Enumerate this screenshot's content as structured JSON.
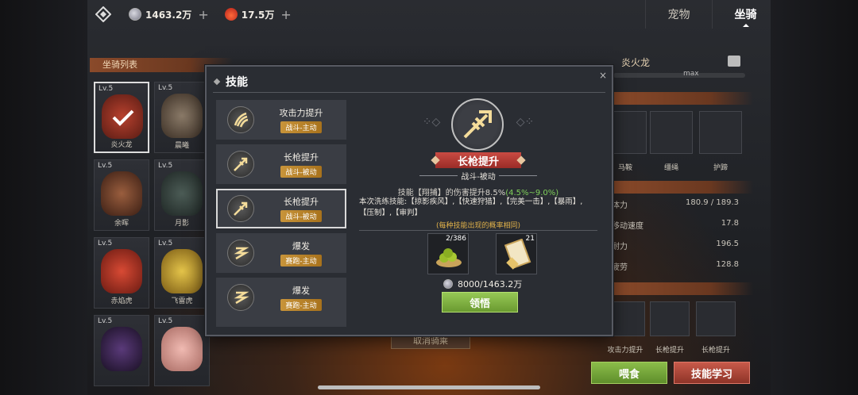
{
  "topbar": {
    "silver_amount": "1463.2万",
    "fire_amount": "17.5万",
    "tabs": [
      "宠物",
      "坐骑"
    ],
    "active_tab": "坐骑"
  },
  "mount_list": {
    "header": "坐骑列表",
    "items": [
      {
        "level": "Lv.5",
        "name": "炎火龙",
        "color": "#b8412e"
      },
      {
        "level": "Lv.5",
        "name": "晨曦",
        "color": "#6b5a48"
      },
      {
        "level": "Lv.5",
        "name": "余晖",
        "color": "#8a5338"
      },
      {
        "level": "Lv.5",
        "name": "月影",
        "color": "#3b4a44"
      },
      {
        "level": "Lv.5",
        "name": "赤焰虎",
        "color": "#c23a2a"
      },
      {
        "level": "Lv.5",
        "name": "飞雷虎",
        "color": "#d4b23a"
      },
      {
        "level": "Lv.5",
        "name": "",
        "color": "#3a2a4a"
      },
      {
        "level": "Lv.5",
        "name": "",
        "color": "#e0a7a0"
      }
    ]
  },
  "right_panel": {
    "mount_name": "炎火龙",
    "level_label": "max",
    "equip": [
      {
        "label": "马鞍"
      },
      {
        "label": "缰绳"
      },
      {
        "label": "护蹄"
      }
    ],
    "stats": [
      {
        "label": "体力",
        "value": "180.9 / 189.3"
      },
      {
        "label": "移动速度",
        "value": "17.8"
      },
      {
        "label": "耐力",
        "value": "196.5"
      },
      {
        "label": "疲劳",
        "value": "128.8"
      }
    ],
    "skills": [
      "攻击力提升",
      "长枪提升",
      "长枪提升"
    ],
    "feed_button": "喂食",
    "learn_button": "技能学习"
  },
  "cancel_label": "取消骑乘",
  "modal": {
    "title": "技能",
    "close": "×",
    "skills": [
      {
        "name": "攻击力提升",
        "tag": "战斗-主动",
        "icon": "claw-icon"
      },
      {
        "name": "长枪提升",
        "tag": "战斗-被动",
        "icon": "spear-icon"
      },
      {
        "name": "长枪提升",
        "tag": "战斗-被动",
        "icon": "spear-icon"
      },
      {
        "name": "爆发",
        "tag": "赛跑-主动",
        "icon": "burst-icon"
      },
      {
        "name": "爆发",
        "tag": "赛跑-主动",
        "icon": "burst-icon"
      }
    ],
    "detail": {
      "name": "长枪提升",
      "type": "战斗-被动",
      "desc_prefix": "技能【翔捕】的伤害提升8.5%",
      "desc_range": "(4.5%~9.0%)",
      "desc_pool": "本次洗练技能:【掠影疾风】,【快速狩猎】,【完美一击】,【暴雨】,【压制】,【审判】",
      "probability_note": "(每种技能出现的概率相同)",
      "items": [
        {
          "count": "2/386",
          "icon": "green-fruit-icon"
        },
        {
          "count": "21",
          "icon": "scroll-icon"
        }
      ],
      "cost": "8000/1463.2万",
      "button": "领悟"
    }
  }
}
